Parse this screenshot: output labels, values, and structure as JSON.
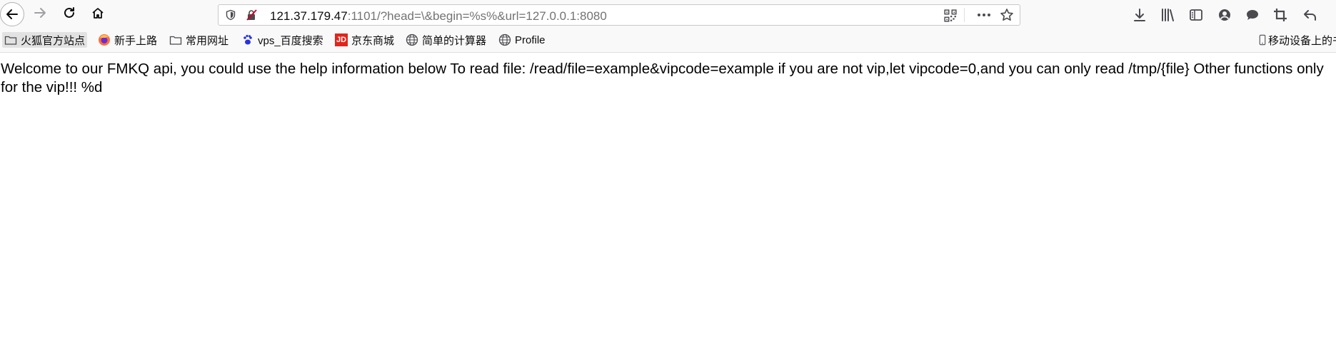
{
  "toolbar": {
    "url_host": "121.37.179.47",
    "url_rest": ":1101/?head=\\&begin=%s%&url=127.0.0.1:8080"
  },
  "bookmarks": {
    "items": [
      {
        "label": "火狐官方站点",
        "icon": "folder-icon"
      },
      {
        "label": "新手上路",
        "icon": "firefox-icon"
      },
      {
        "label": "常用网址",
        "icon": "folder-icon"
      },
      {
        "label": "vps_百度搜索",
        "icon": "baidu-paw-icon"
      },
      {
        "label": "京东商城",
        "icon": "jd-icon"
      },
      {
        "label": "简单的计算器",
        "icon": "globe-icon"
      },
      {
        "label": "Profile",
        "icon": "globe-icon"
      }
    ],
    "mobile_label": "移动设备上的书签",
    "jd_glyph": "JD"
  },
  "page": {
    "body_text": "Welcome to our FMKQ api, you could use the help information below To read file: /read/file=example&vipcode=example if you are not vip,let vipcode=0,and you can only read /tmp/{file} Other functions only for the vip!!! %d"
  },
  "colors": {
    "accent": "#0a84ff",
    "toolbar_bg": "#f9f9fa",
    "jd_red": "#e1251b",
    "insecure_red": "#d70022"
  }
}
